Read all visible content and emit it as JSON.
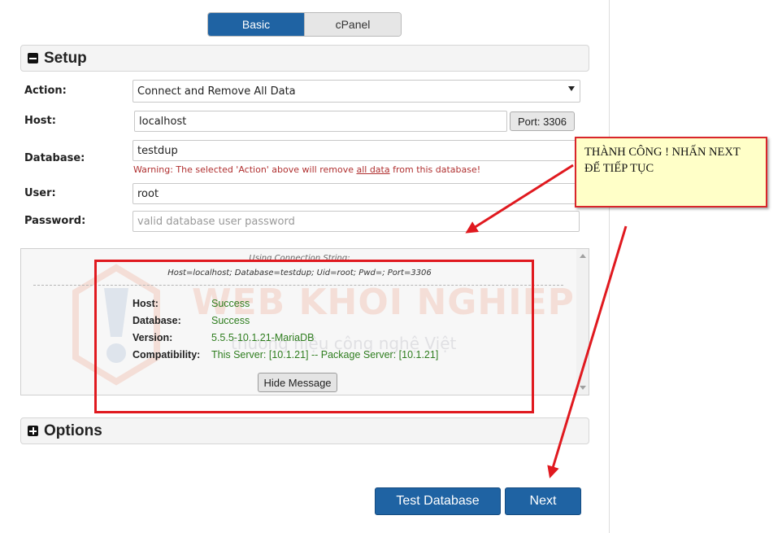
{
  "mode_toggle": {
    "basic": "Basic",
    "cpanel": "cPanel"
  },
  "setup": {
    "title": "Setup",
    "action": {
      "label": "Action:",
      "value": "Connect and Remove All Data"
    },
    "host": {
      "label": "Host:",
      "value": "localhost",
      "port_button": "Port: 3306"
    },
    "database": {
      "label": "Database:",
      "value": "testdup",
      "warning_prefix": "Warning: The selected 'Action' above will remove ",
      "warning_link": "all data",
      "warning_suffix": " from this database!"
    },
    "user": {
      "label": "User:",
      "value": "root"
    },
    "password": {
      "label": "Password:",
      "placeholder": "valid database user password"
    }
  },
  "message": {
    "conn_title": "Using Connection String:",
    "conn_string": "Host=localhost; Database=testdup; Uid=root; Pwd=; Port=3306",
    "rows": [
      {
        "label": "Host:",
        "value": "Success"
      },
      {
        "label": "Database:",
        "value": "Success"
      },
      {
        "label": "Version:",
        "value": "5.5.5-10.1.21-MariaDB"
      },
      {
        "label": "Compatibility:",
        "value": "This Server: [10.1.21] -- Package Server: [10.1.21]"
      }
    ],
    "hide_button": "Hide Message",
    "watermark_title": "WEB KHOI NGHIEP",
    "watermark_sub": "thương hiệu công nghệ Việt"
  },
  "options": {
    "title": "Options"
  },
  "footer": {
    "test_button": "Test Database",
    "next_button": "Next"
  },
  "annotation": {
    "note": "THÀNH CÔNG ! NHẤN NEXT ĐỂ TIẾP TỤC"
  },
  "colors": {
    "primary": "#1f63a3",
    "success": "#2e7d1e",
    "warning": "#b03030",
    "annotation_red": "#e0191f",
    "note_bg": "#ffffc8"
  }
}
